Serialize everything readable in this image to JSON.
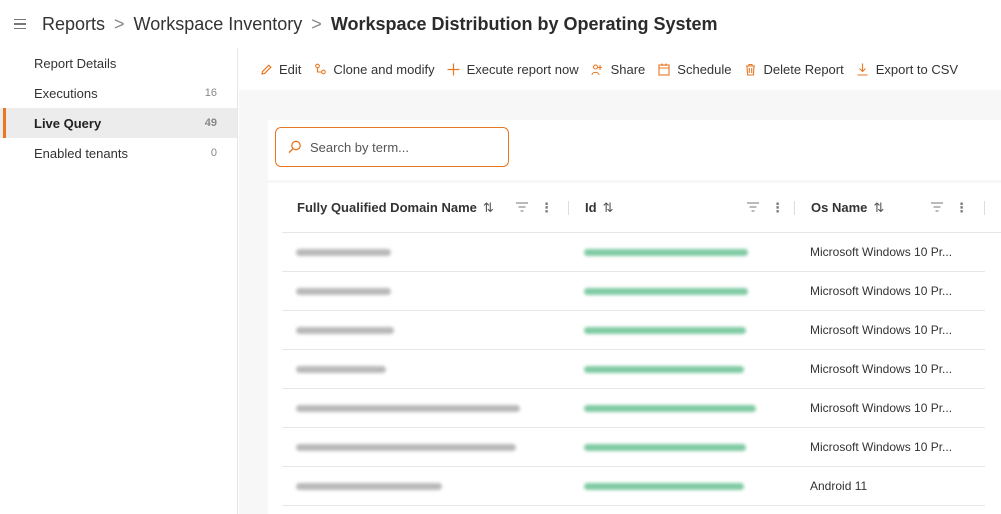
{
  "breadcrumb": {
    "items": [
      "Reports",
      "Workspace Inventory"
    ],
    "current": "Workspace Distribution by Operating System",
    "separator": ">"
  },
  "sidebar": {
    "items": [
      {
        "label": "Report Details",
        "count": ""
      },
      {
        "label": "Executions",
        "count": "16"
      },
      {
        "label": "Live Query",
        "count": "49"
      },
      {
        "label": "Enabled tenants",
        "count": "0"
      }
    ]
  },
  "toolbar": {
    "edit": "Edit",
    "clone": "Clone and modify",
    "execute": "Execute report now",
    "share": "Share",
    "schedule": "Schedule",
    "delete": "Delete Report",
    "export": "Export to CSV"
  },
  "search": {
    "placeholder": "Search by term..."
  },
  "table": {
    "columns": [
      "Fully Qualified Domain Name",
      "Id",
      "Os Name"
    ],
    "rows": [
      {
        "os": "Microsoft Windows 10 Pr..."
      },
      {
        "os": "Microsoft Windows 10 Pr..."
      },
      {
        "os": "Microsoft Windows 10 Pr..."
      },
      {
        "os": "Microsoft Windows 10 Pr..."
      },
      {
        "os": "Microsoft Windows 10 Pr..."
      },
      {
        "os": "Microsoft Windows 10 Pr..."
      },
      {
        "os": "Android 11"
      }
    ]
  },
  "colors": {
    "accent": "#e87722",
    "blur_text": "#b9b9b9",
    "blur_id": "#7fcaa3"
  }
}
